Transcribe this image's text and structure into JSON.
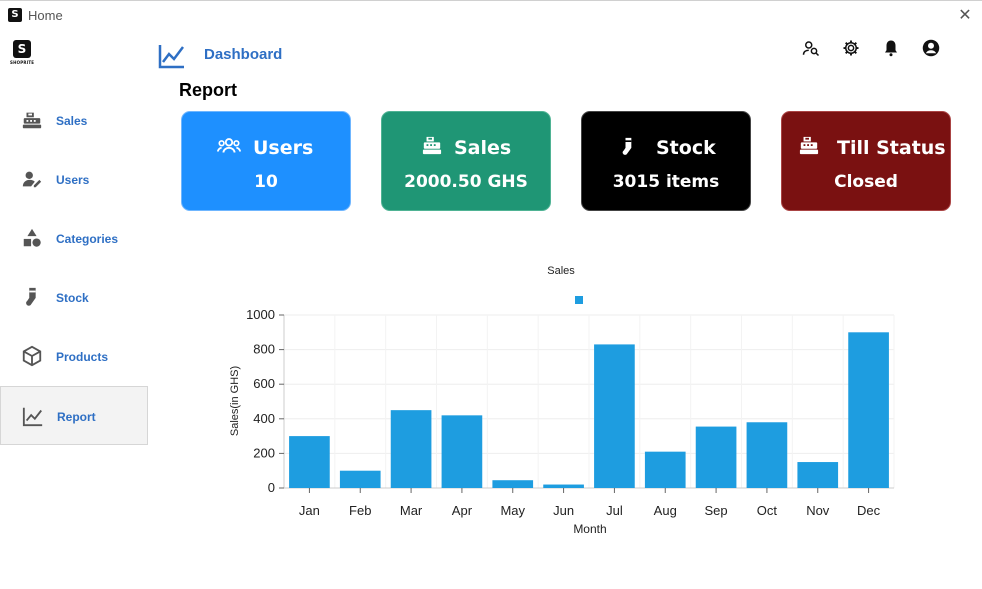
{
  "window": {
    "title": "Home",
    "close_glyph": "✕",
    "app_icon": "S"
  },
  "logo": {
    "mark": "S",
    "brand": "SHOPRITE"
  },
  "sidebar": {
    "items": [
      {
        "label": "Sales",
        "icon": "cash-register-icon"
      },
      {
        "label": "Users",
        "icon": "user-edit-icon"
      },
      {
        "label": "Categories",
        "icon": "shapes-icon"
      },
      {
        "label": "Stock",
        "icon": "sock-icon"
      },
      {
        "label": "Products",
        "icon": "box-icon"
      },
      {
        "label": "Report",
        "icon": "chart-line-icon",
        "active": true
      }
    ]
  },
  "header": {
    "title": "Dashboard",
    "icons": [
      "user-search-icon",
      "gear-icon",
      "bell-icon",
      "account-icon"
    ]
  },
  "page": {
    "title": "Report"
  },
  "cards": [
    {
      "label": "Users",
      "value": "10",
      "icon": "users-icon",
      "color": "#1e90ff"
    },
    {
      "label": "Sales",
      "value": "2000.50 GHS",
      "icon": "cash-register-icon",
      "color": "#1f9675"
    },
    {
      "label": "Stock",
      "value": "3015 items",
      "icon": "sock-icon",
      "color": "#000000"
    },
    {
      "label": "Till Status",
      "value": "Closed",
      "icon": "cash-register-icon",
      "color": "#7a1111"
    }
  ],
  "chart_data": {
    "type": "bar",
    "title": "Sales",
    "xlabel": "Month",
    "ylabel": "Sales(in GHS)",
    "categories": [
      "Jan",
      "Feb",
      "Mar",
      "Apr",
      "May",
      "Jun",
      "Jul",
      "Aug",
      "Sep",
      "Oct",
      "Nov",
      "Dec"
    ],
    "values": [
      300,
      100,
      450,
      420,
      45,
      20,
      830,
      210,
      355,
      380,
      150,
      900
    ],
    "ylim": [
      0,
      1000
    ],
    "yticks": [
      0,
      200,
      400,
      600,
      800,
      1000
    ],
    "grid": true,
    "legend": "top-center",
    "bar_color": "#1e9de0"
  }
}
